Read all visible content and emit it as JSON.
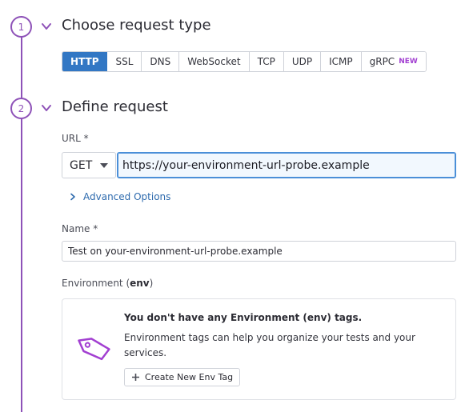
{
  "steps": [
    {
      "number": "1",
      "title": "Choose request type"
    },
    {
      "number": "2",
      "title": "Define request"
    }
  ],
  "request_types": [
    {
      "label": "HTTP",
      "active": true
    },
    {
      "label": "SSL"
    },
    {
      "label": "DNS"
    },
    {
      "label": "WebSocket"
    },
    {
      "label": "TCP"
    },
    {
      "label": "UDP"
    },
    {
      "label": "ICMP"
    },
    {
      "label": "gRPC",
      "badge": "NEW"
    }
  ],
  "url": {
    "label": "URL *",
    "method": "GET",
    "value": "https://your-environment-url-probe.example"
  },
  "advanced_options": "Advanced Options",
  "name": {
    "label": "Name *",
    "value": "Test on your-environment-url-probe.example"
  },
  "environment": {
    "label_prefix": "Environment (",
    "label_key": "env",
    "label_suffix": ")",
    "empty_title": "You don't have any Environment (env) tags.",
    "empty_desc": "Environment tags can help you organize your tests and your services.",
    "create_button": "Create New Env Tag"
  },
  "colors": {
    "step_accent": "#8e52b8",
    "primary": "#3277c4",
    "link": "#2d6aad",
    "badge_new": "#a23fd1"
  }
}
